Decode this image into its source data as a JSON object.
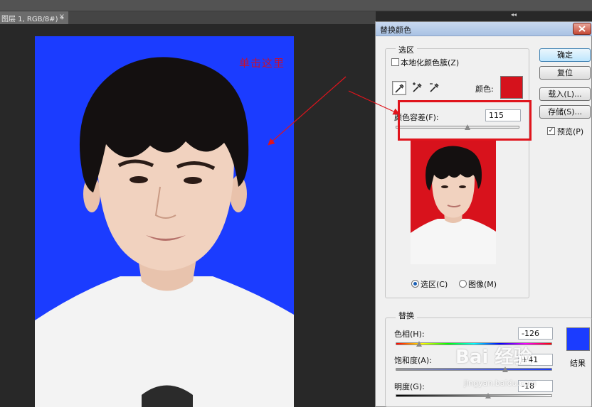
{
  "workspace": {
    "doc_tab": "图层 1, RGB/8#) *",
    "doc_tab_close": "×",
    "panel_collapse": "◂◂"
  },
  "annotation": {
    "text": "单击这里"
  },
  "dialog": {
    "title": "替换颜色",
    "selection_group": {
      "legend": "选区",
      "localized_clusters_label": "本地化颜色簇(Z)",
      "localized_clusters_checked": false,
      "color_label": "颜色:",
      "color_swatch": "#d5121c",
      "fuzziness_label": "颜色容差(F):",
      "fuzziness_value": "115",
      "fuzziness_level": 0.58,
      "mode_selection_label": "选区(C)",
      "mode_image_label": "图像(M)",
      "mode_selected": "selection"
    },
    "buttons": {
      "ok": "确定",
      "reset": "复位",
      "load": "载入(L)...",
      "save": "存储(S)..."
    },
    "preview_label": "预览(P)",
    "preview_checked": true,
    "checkmark": "✓",
    "replacement_group": {
      "legend": "替换",
      "hue_label": "色相(H):",
      "hue_value": "-126",
      "hue_level": 0.15,
      "saturation_label": "饱和度(A):",
      "saturation_value": "+41",
      "saturation_level": 0.7,
      "lightness_label": "明度(G):",
      "lightness_value": "-18",
      "lightness_level": 0.59,
      "result_label": "结果",
      "result_swatch": "#1b3cff"
    }
  },
  "watermark": {
    "logo": "Bai 经验",
    "url": "jingyan.baidu.com"
  },
  "colors": {
    "photo_background": "#1b3cff",
    "preview_background": "#d8121c",
    "annotation_red": "#e0141c"
  }
}
